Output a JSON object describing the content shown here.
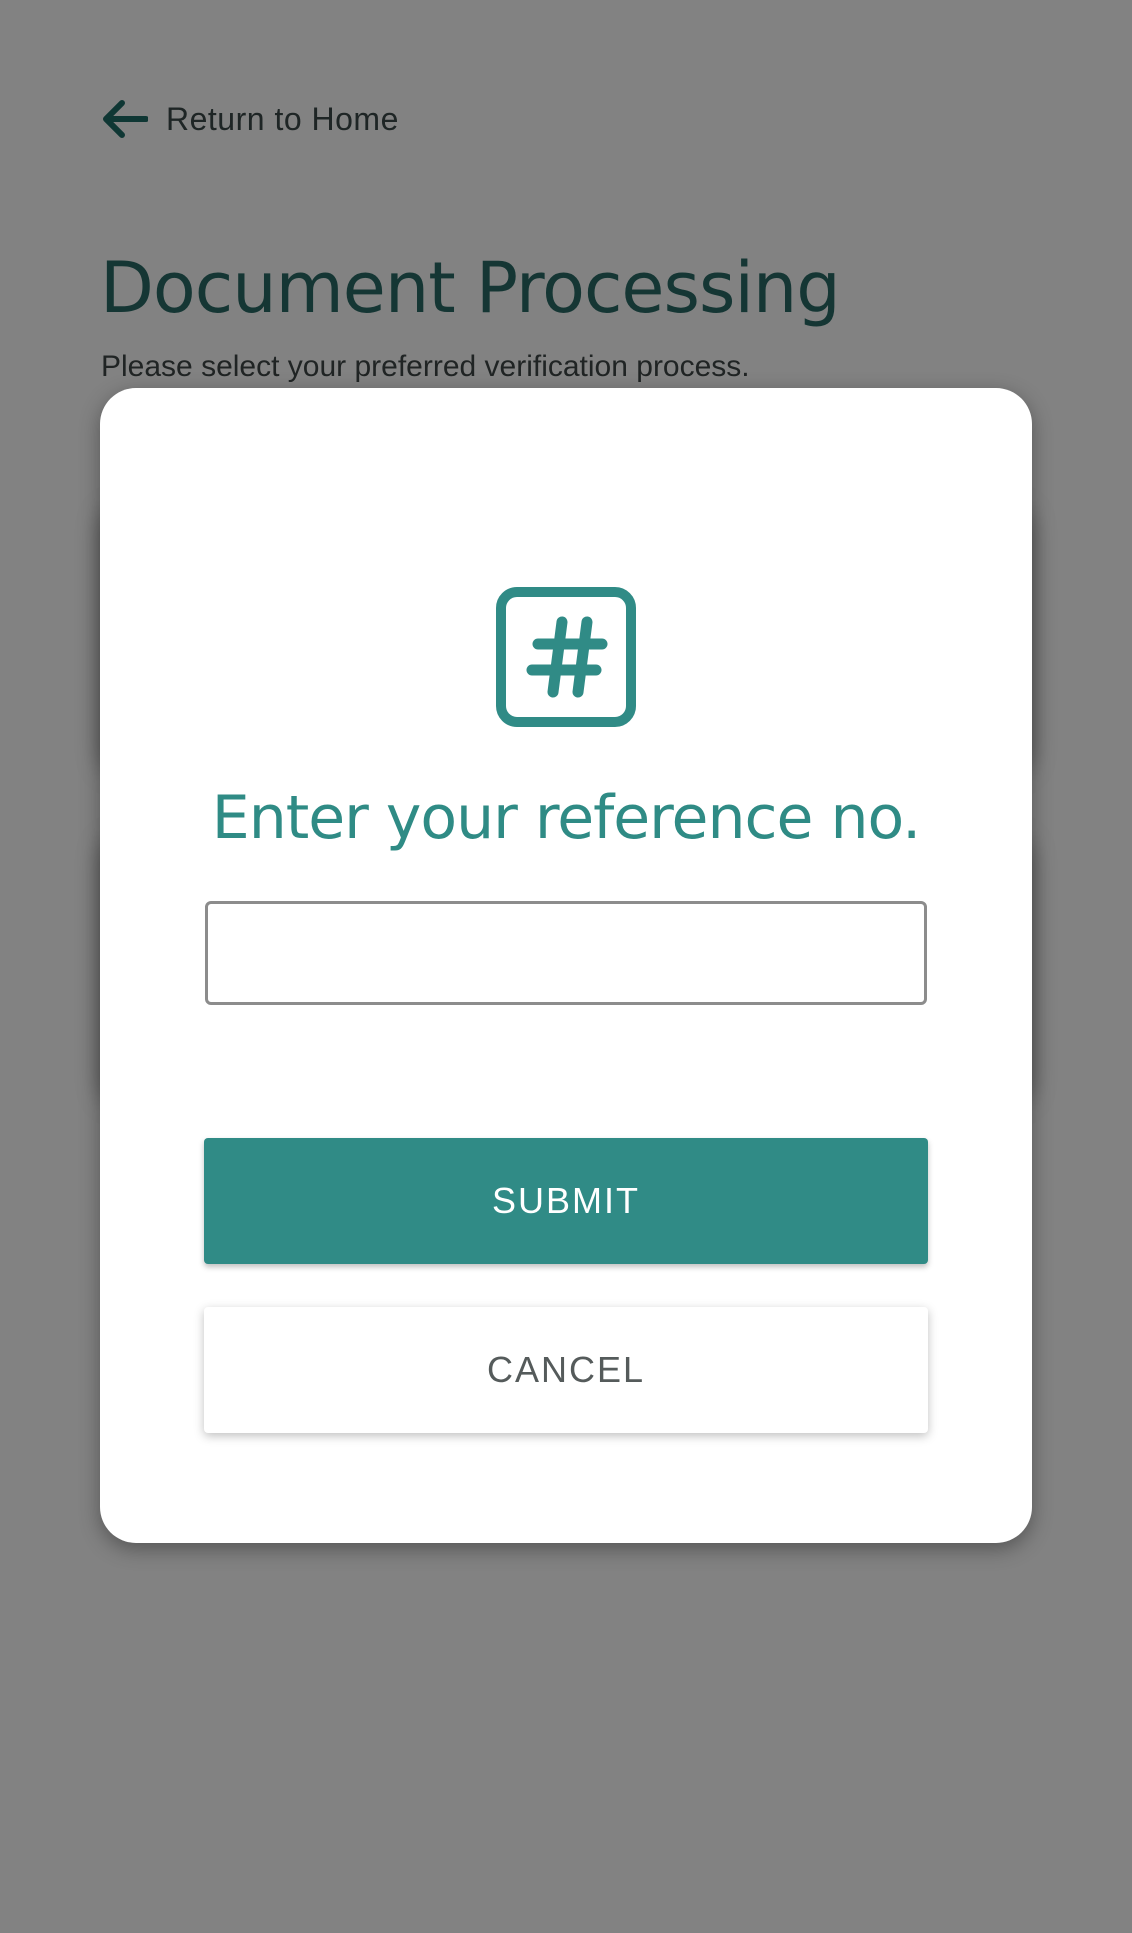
{
  "page": {
    "back_link_label": "Return to Home",
    "title": "Document Processing",
    "subtitle": "Please select your preferred verification process."
  },
  "modal": {
    "icon": "hash-box-icon",
    "title": "Enter your reference no.",
    "input_value": "",
    "submit_label": "SUBMIT",
    "cancel_label": "CANCEL"
  },
  "colors": {
    "accent": "#308b86",
    "title_dark": "#2a6b66",
    "overlay": "#808080"
  }
}
